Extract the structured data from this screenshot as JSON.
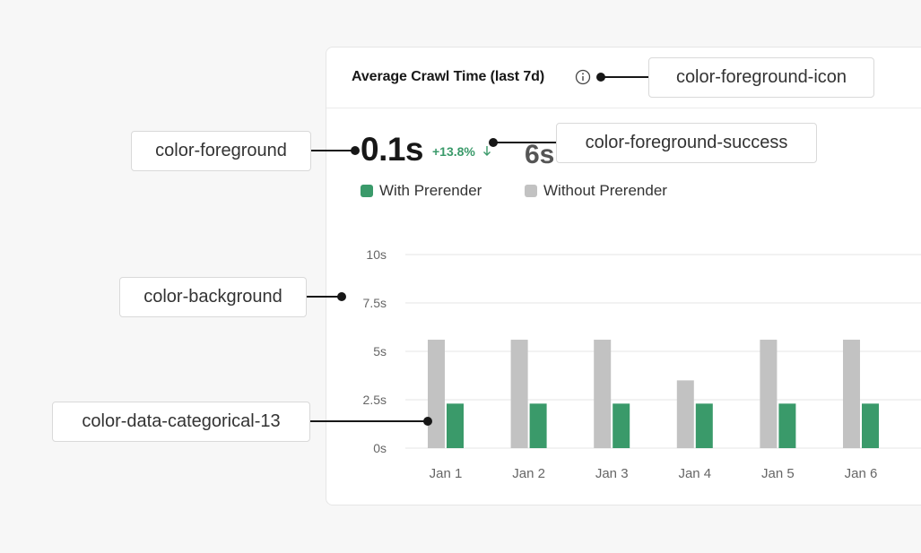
{
  "card": {
    "title": "Average Crawl Time (last 7d)",
    "info_icon": "info-circle-icon"
  },
  "metric": {
    "value": "0.1s",
    "delta": "+13.8%",
    "delta_icon": "arrow-down-icon",
    "secondary": "6s"
  },
  "annotations": {
    "icon": "color-foreground-icon",
    "foreground": "color-foreground",
    "success": "color-foreground-success",
    "background": "color-background",
    "categorical": "color-data-categorical-13"
  },
  "colors": {
    "with_prerender": "#3a9a6a",
    "without_prerender": "#c2c2c2",
    "success_text": "#3a9a6a",
    "grid": "#e5e5e5",
    "axis_text": "#666666"
  },
  "chart_data": {
    "type": "bar",
    "categories": [
      "Jan 1",
      "Jan 2",
      "Jan 3",
      "Jan 4",
      "Jan 5",
      "Jan 6"
    ],
    "series": [
      {
        "name": "Without Prerender",
        "values": [
          5.6,
          5.6,
          5.6,
          3.5,
          5.6,
          5.6
        ]
      },
      {
        "name": "With Prerender",
        "values": [
          2.3,
          2.3,
          2.3,
          2.3,
          2.3,
          2.3
        ]
      }
    ],
    "yticks": [
      "0s",
      "2.5s",
      "5s",
      "7.5s",
      "10s"
    ],
    "ylim": [
      0,
      10
    ],
    "grid": true,
    "legend_position": "top-left"
  }
}
